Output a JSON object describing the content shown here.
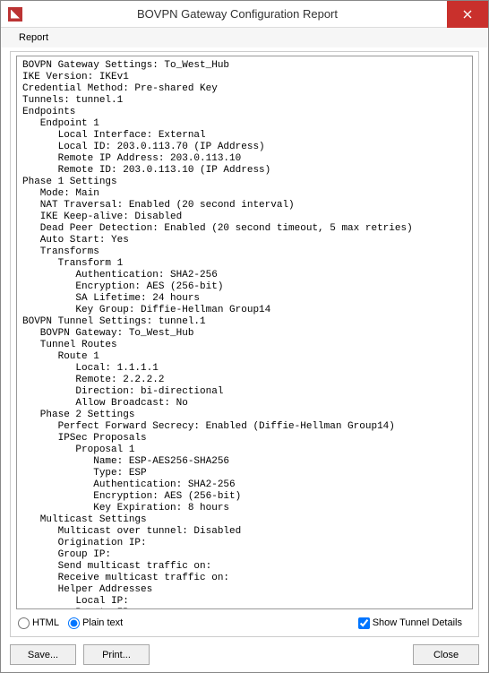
{
  "window": {
    "title": "BOVPN Gateway Configuration Report"
  },
  "menu": {
    "report": "Report"
  },
  "report_lines": [
    "BOVPN Gateway Settings: To_West_Hub",
    "IKE Version: IKEv1",
    "Credential Method: Pre-shared Key",
    "Tunnels: tunnel.1",
    "Endpoints",
    "   Endpoint 1",
    "      Local Interface: External",
    "      Local ID: 203.0.113.70 (IP Address)",
    "      Remote IP Address: 203.0.113.10",
    "      Remote ID: 203.0.113.10 (IP Address)",
    "Phase 1 Settings",
    "   Mode: Main",
    "   NAT Traversal: Enabled (20 second interval)",
    "   IKE Keep-alive: Disabled",
    "   Dead Peer Detection: Enabled (20 second timeout, 5 max retries)",
    "   Auto Start: Yes",
    "   Transforms",
    "      Transform 1",
    "         Authentication: SHA2-256",
    "         Encryption: AES (256-bit)",
    "         SA Lifetime: 24 hours",
    "         Key Group: Diffie-Hellman Group14",
    "BOVPN Tunnel Settings: tunnel.1",
    "   BOVPN Gateway: To_West_Hub",
    "   Tunnel Routes",
    "      Route 1",
    "         Local: 1.1.1.1",
    "         Remote: 2.2.2.2",
    "         Direction: bi-directional",
    "         Allow Broadcast: No",
    "   Phase 2 Settings",
    "      Perfect Forward Secrecy: Enabled (Diffie-Hellman Group14)",
    "      IPSec Proposals",
    "         Proposal 1",
    "            Name: ESP-AES256-SHA256",
    "            Type: ESP",
    "            Authentication: SHA2-256",
    "            Encryption: AES (256-bit)",
    "            Key Expiration: 8 hours",
    "   Multicast Settings",
    "      Multicast over tunnel: Disabled",
    "      Origination IP:",
    "      Group IP:",
    "      Send multicast traffic on:",
    "      Receive multicast traffic on:",
    "      Helper Addresses",
    "         Local IP:",
    "         Remote IP:"
  ],
  "format": {
    "html_label": "HTML",
    "plain_label": "Plain text",
    "selected": "plain",
    "show_tunnel_label": "Show Tunnel Details",
    "show_tunnel_checked": true
  },
  "buttons": {
    "save": "Save...",
    "print": "Print...",
    "close": "Close"
  }
}
